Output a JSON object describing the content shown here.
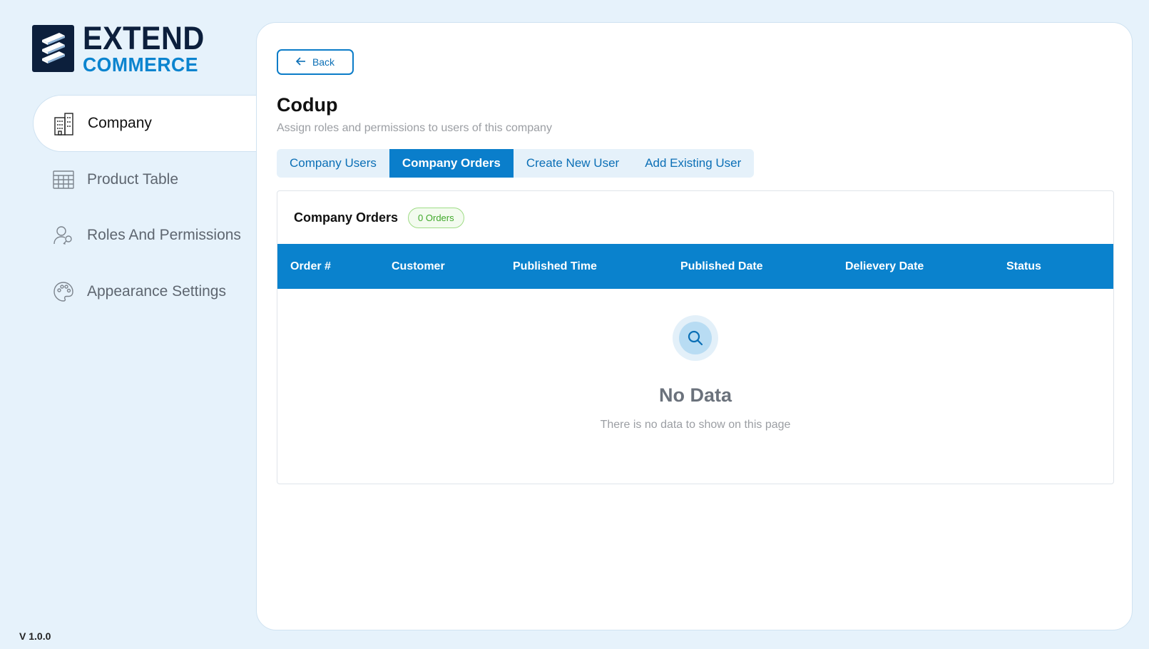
{
  "brand": {
    "line1": "EXTEND",
    "line2": "COMMERCE",
    "colors": {
      "navy": "#0c1f3c",
      "blue": "#0b84cf"
    }
  },
  "sidebar": {
    "items": [
      {
        "label": "Company",
        "icon": "building-icon",
        "active": true
      },
      {
        "label": "Product Table",
        "icon": "table-grid-icon",
        "active": false
      },
      {
        "label": "Roles And Permissions",
        "icon": "user-key-icon",
        "active": false
      },
      {
        "label": "Appearance Settings",
        "icon": "palette-icon",
        "active": false
      }
    ],
    "version": "V 1.0.0"
  },
  "main": {
    "back_label": "Back",
    "title": "Codup",
    "subtitle": "Assign roles and permissions to users of this company",
    "tabs": [
      {
        "label": "Company Users",
        "active": false
      },
      {
        "label": "Company Orders",
        "active": true
      },
      {
        "label": "Create New User",
        "active": false
      },
      {
        "label": "Add Existing User",
        "active": false
      }
    ],
    "orders": {
      "title": "Company Orders",
      "badge": "0 Orders",
      "columns": [
        "Order #",
        "Customer",
        "Published Time",
        "Published Date",
        "Delievery Date",
        "Status"
      ],
      "rows": [],
      "empty_title": "No Data",
      "empty_text": "There is no data to show on this page"
    }
  },
  "colors": {
    "accent": "#0a82cd",
    "badge_green": "#3fa82a",
    "background": "#e6f2fb"
  }
}
